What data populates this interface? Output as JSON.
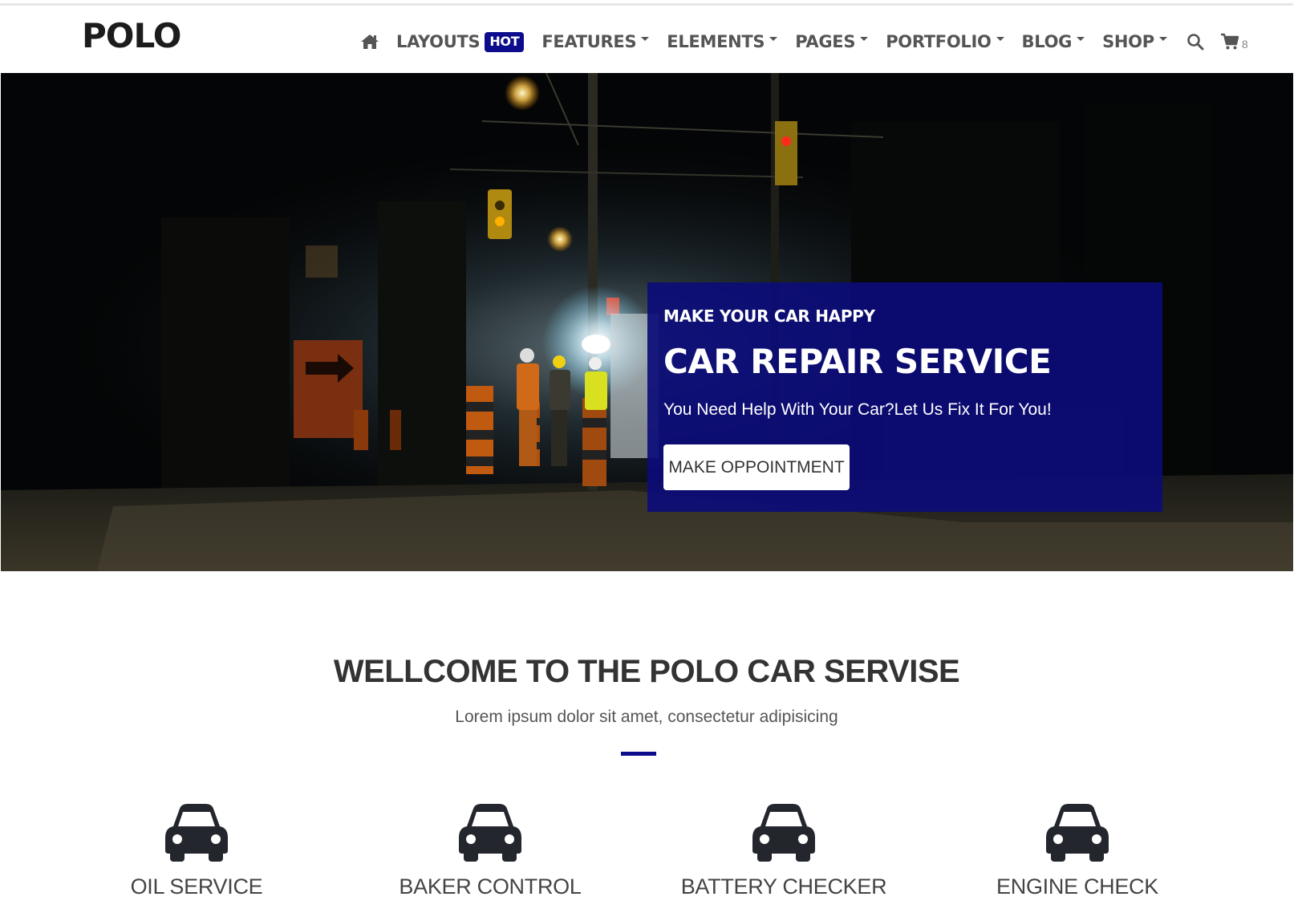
{
  "header": {
    "logo": "POLO",
    "nav": [
      {
        "label": "LAYOUTS",
        "badge": "HOT",
        "dropdown": false
      },
      {
        "label": "FEATURES",
        "dropdown": true
      },
      {
        "label": "ELEMENTS",
        "dropdown": true
      },
      {
        "label": "PAGES",
        "dropdown": true
      },
      {
        "label": "PORTFOLIO",
        "dropdown": true
      },
      {
        "label": "BLOG",
        "dropdown": true
      },
      {
        "label": "SHOP",
        "dropdown": true
      }
    ],
    "cart_count": "8",
    "icons": {
      "home": "home-icon",
      "search": "search-icon",
      "cart": "cart-icon"
    }
  },
  "hero": {
    "kicker": "MAKE YOUR CAR HAPPY",
    "title": "CAR REPAIR SERVICE",
    "subtitle": "You Need Help With Your Car?Let Us Fix It For You!",
    "button_label": "MAKE OPPOINTMENT",
    "image": "night road-work scene with workers"
  },
  "welcome": {
    "title": "WELLCOME TO THE POLO CAR SERVISE",
    "subtitle": "Lorem ipsum dolor sit amet, consectetur adipisicing"
  },
  "services": [
    {
      "label": "OIL SERVICE",
      "icon": "car-icon"
    },
    {
      "label": "BAKER CONTROL",
      "icon": "car-icon"
    },
    {
      "label": "BATTERY CHECKER",
      "icon": "car-icon"
    },
    {
      "label": "ENGINE CHECK",
      "icon": "car-icon"
    }
  ],
  "colors": {
    "accent": "#0c0c8c",
    "nav_text": "#555555",
    "hero_box": "#0c0c78"
  }
}
